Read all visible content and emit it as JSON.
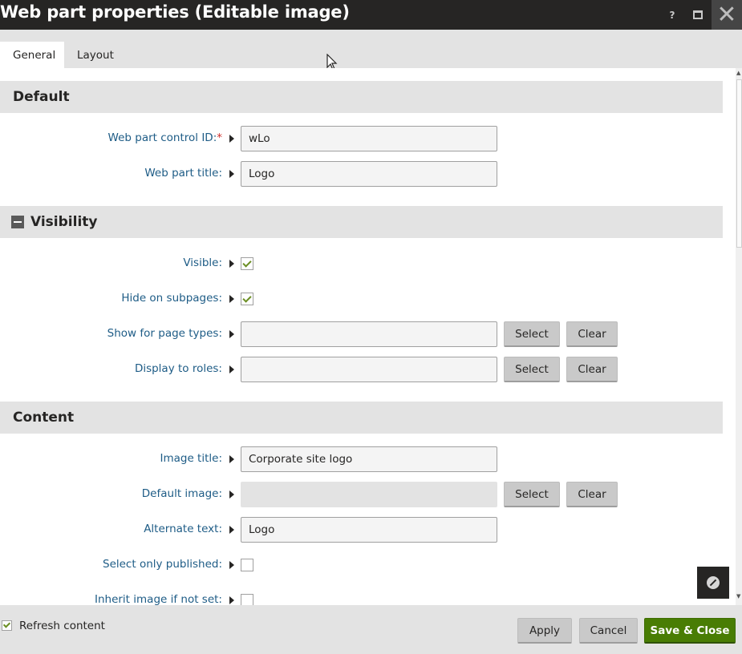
{
  "window": {
    "title": "Web part properties (Editable image)",
    "help_label": "?"
  },
  "tabs": [
    {
      "label": "General",
      "active": true
    },
    {
      "label": "Layout",
      "active": false
    }
  ],
  "sections": {
    "default": {
      "title": "Default",
      "web_part_control_id": {
        "label": "Web part control ID:",
        "required_mark": "*",
        "value": "wLo"
      },
      "web_part_title": {
        "label": "Web part title:",
        "value": "Logo"
      }
    },
    "visibility": {
      "title": "Visibility",
      "collapsible": true,
      "visible": {
        "label": "Visible:",
        "checked": true
      },
      "hide_on_subpages": {
        "label": "Hide on subpages:",
        "checked": true
      },
      "show_for_page_types": {
        "label": "Show for page types:",
        "value": ""
      },
      "display_to_roles": {
        "label": "Display to roles:",
        "value": ""
      }
    },
    "content": {
      "title": "Content",
      "image_title": {
        "label": "Image title:",
        "value": "Corporate site logo"
      },
      "default_image": {
        "label": "Default image:",
        "value": ""
      },
      "alternate_text": {
        "label": "Alternate text:",
        "value": "Logo"
      },
      "select_only_published": {
        "label": "Select only published:",
        "checked": false
      },
      "inherit_image": {
        "label": "Inherit image if not set:",
        "checked": false
      }
    }
  },
  "buttons": {
    "select": "Select",
    "clear": "Clear"
  },
  "footer": {
    "refresh_content": {
      "label": "Refresh content",
      "checked": true
    },
    "apply": "Apply",
    "cancel": "Cancel",
    "save_close": "Save & Close"
  },
  "colors": {
    "titlebar": "#262524",
    "label_blue": "#1e5c86",
    "section_bg": "#e3e3e3",
    "primary_green": "#497d04"
  },
  "icons": {
    "help": "question-icon",
    "maximize": "maximize-icon",
    "close": "close-icon",
    "collapse": "minus-icon",
    "compass": "compass-icon"
  }
}
